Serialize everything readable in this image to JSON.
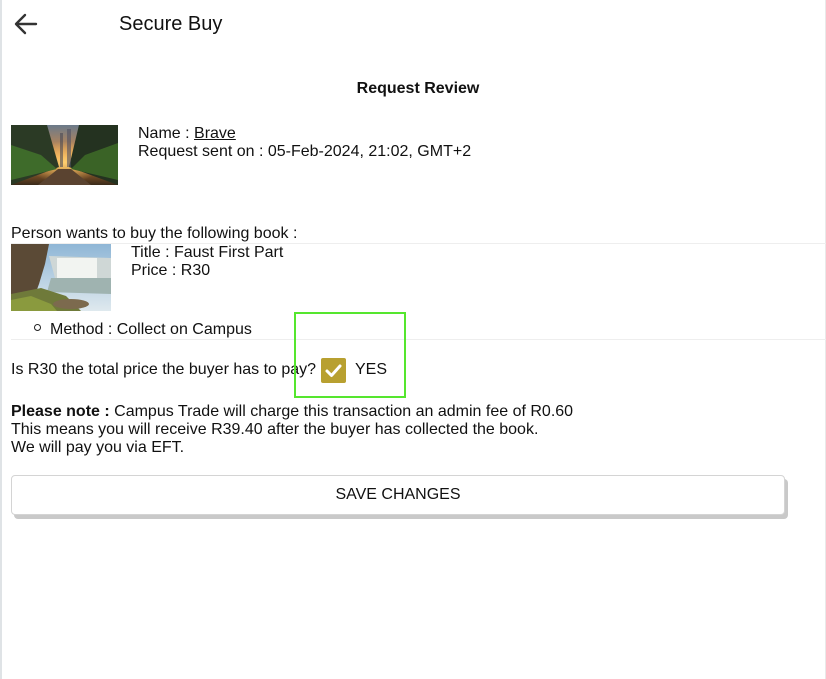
{
  "header": {
    "title": "Secure Buy",
    "back_icon": "arrow-left-icon"
  },
  "page": {
    "heading": "Request Review"
  },
  "request": {
    "name_label": "Name : ",
    "name_value": "Brave",
    "sent_label": "Request sent on : ",
    "sent_value": "05-Feb-2024, 21:02, GMT+2"
  },
  "book": {
    "intro": "Person wants to buy the following book :",
    "title_label": "Title : ",
    "title_value": "Faust First Part",
    "price_label": "Price : ",
    "price_value": "R30",
    "method_label": "Method : ",
    "method_value": "Collect on Campus"
  },
  "confirm": {
    "question": "Is R30 the total price the buyer has to pay?",
    "checked": true,
    "option_label": "YES",
    "checkbox_color": "#b8a030",
    "focus_color": "#55e62e"
  },
  "note": {
    "bold": "Please note :",
    "line1": " Campus Trade will charge this transaction an admin fee of R0.60",
    "line2": "This means you will receive R39.40 after the buyer has collected the book.",
    "line3": "We will pay you via EFT."
  },
  "actions": {
    "save_label": "SAVE CHANGES"
  }
}
